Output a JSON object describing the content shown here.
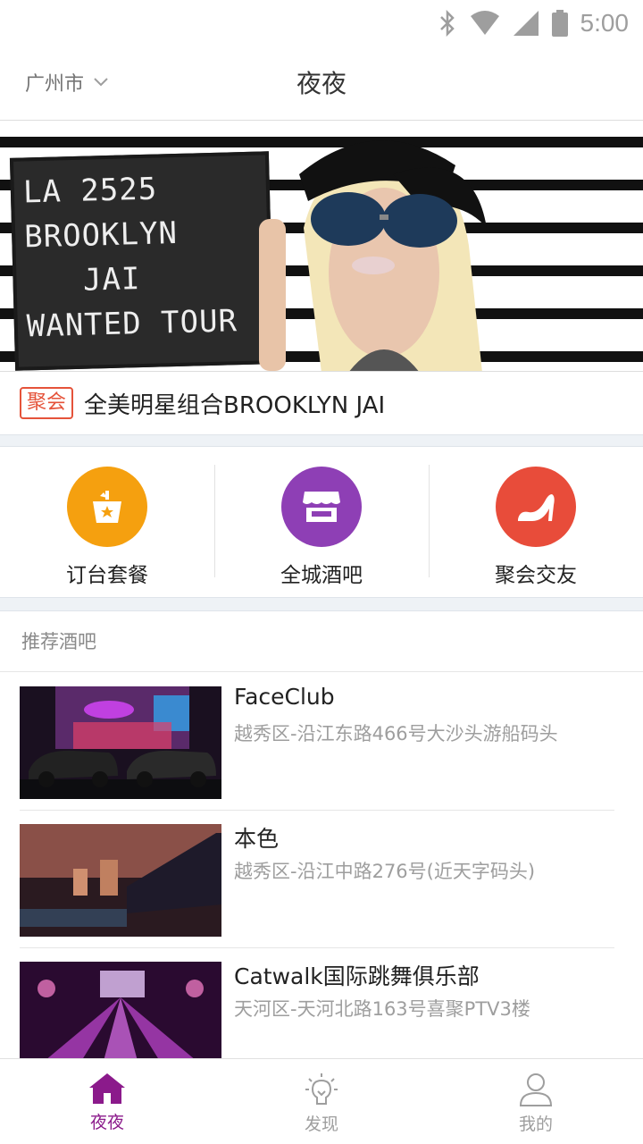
{
  "status_bar": {
    "time": "5:00"
  },
  "header": {
    "city": "广州市",
    "title": "夜夜"
  },
  "banner": {
    "board_text": "LA 2525\nBROOKLYN\n   JAI\nWANTED TOUR",
    "tag": "聚会",
    "caption": "全美明星组合BROOKLYN JAI"
  },
  "categories": [
    {
      "label": "订台套餐",
      "icon": "champagne-bucket-icon",
      "color": "#f5a00f"
    },
    {
      "label": "全城酒吧",
      "icon": "storefront-icon",
      "color": "#8e3fb5"
    },
    {
      "label": "聚会交友",
      "icon": "high-heel-icon",
      "color": "#e84c3a"
    }
  ],
  "section": {
    "title": "推荐酒吧"
  },
  "bars": [
    {
      "name": "FaceClub",
      "address": "越秀区-沿江东路466号大沙头游船码头"
    },
    {
      "name": "本色",
      "address": "越秀区-沿江中路276号(近天字码头)"
    },
    {
      "name": "Catwalk国际跳舞俱乐部",
      "address": "天河区-天河北路163号喜聚PTV3楼"
    }
  ],
  "bottom_nav": [
    {
      "label": "夜夜",
      "icon": "home-icon",
      "active": true
    },
    {
      "label": "发现",
      "icon": "lightbulb-icon",
      "active": false
    },
    {
      "label": "我的",
      "icon": "user-icon",
      "active": false
    }
  ],
  "colors": {
    "accent": "#8b1a8b",
    "tag": "#e5533a"
  }
}
